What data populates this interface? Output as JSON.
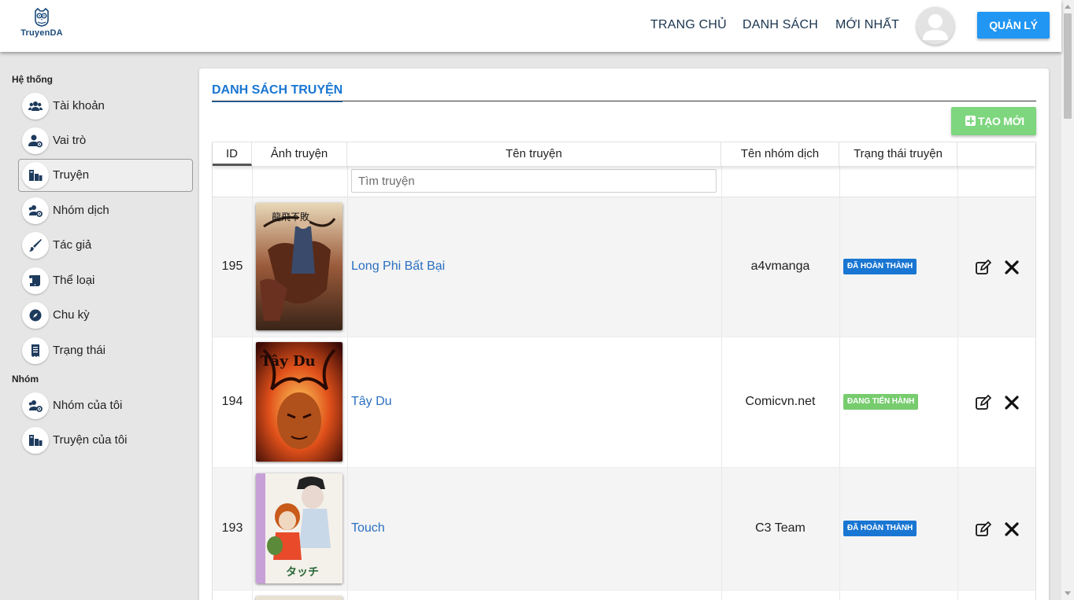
{
  "header": {
    "logo_text": "TruyenDA",
    "nav": [
      {
        "label": "TRANG CHỦ"
      },
      {
        "label": "DANH SÁCH"
      },
      {
        "label": "MỚI NHẤT"
      }
    ],
    "manage_button": "QUẢN LÝ"
  },
  "sidebar": {
    "section_system": "Hệ thống",
    "section_group": "Nhóm",
    "items": [
      {
        "label": "Tài khoản",
        "icon": "users-icon"
      },
      {
        "label": "Vai trò",
        "icon": "user-cog-icon"
      },
      {
        "label": "Truyện",
        "icon": "book-icon",
        "active": true
      },
      {
        "label": "Nhóm dịch",
        "icon": "users-cog-icon"
      },
      {
        "label": "Tác giả",
        "icon": "brush-icon"
      },
      {
        "label": "Thể loại",
        "icon": "scroll-icon"
      },
      {
        "label": "Chu kỳ",
        "icon": "compass-icon"
      },
      {
        "label": "Trạng thái",
        "icon": "receipt-icon"
      }
    ],
    "group_items": [
      {
        "label": "Nhóm của tôi",
        "icon": "users-cog-icon"
      },
      {
        "label": "Truyện của tôi",
        "icon": "book-icon"
      }
    ]
  },
  "main": {
    "title": "DANH SÁCH TRUYỆN",
    "create_button": "TẠO MỚI",
    "columns": [
      "ID",
      "Ảnh truyện",
      "Tên truyện",
      "Tên nhóm dịch",
      "Trạng thái truyện"
    ],
    "search_placeholder": "Tìm truyện",
    "rows": [
      {
        "id": "195",
        "title": "Long Phi Bất Bại",
        "group": "a4vmanga",
        "status": "ĐÃ HOÀN THÀNH",
        "status_color": "#1976d2"
      },
      {
        "id": "194",
        "title": "Tây Du",
        "group": "Comicvn.net",
        "status": "ĐANG TIẾN HÀNH",
        "status_color": "#77cc6e"
      },
      {
        "id": "193",
        "title": "Touch",
        "group": "C3 Team",
        "status": "ĐÃ HOÀN THÀNH",
        "status_color": "#1976d2"
      }
    ]
  },
  "colors": {
    "primary": "#2196f3",
    "link": "#2a6fc1",
    "create": "#7ed67e"
  }
}
